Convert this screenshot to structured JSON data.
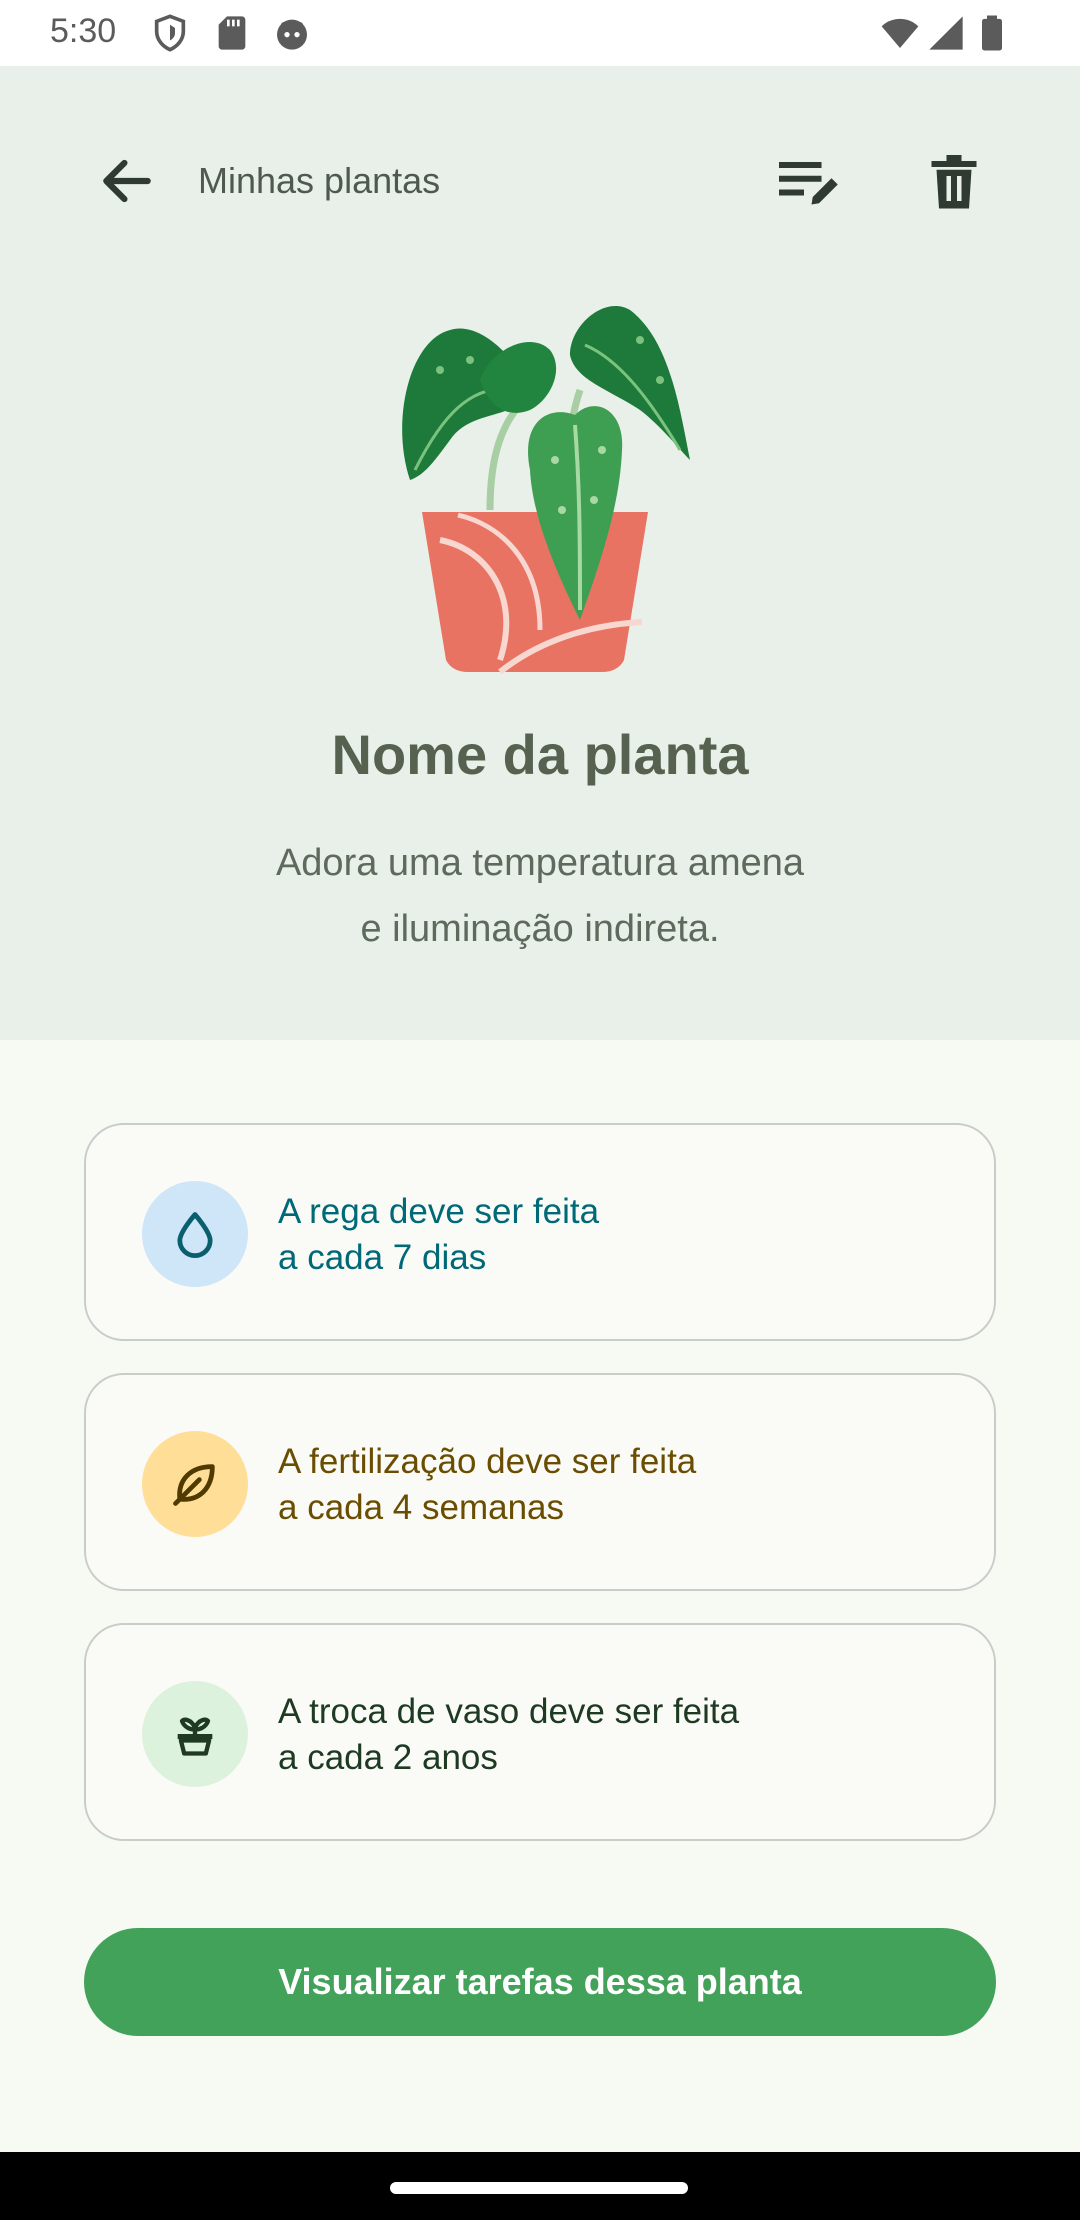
{
  "status_bar": {
    "time": "5:30",
    "left_icons": [
      "shield-icon",
      "sd-card-icon",
      "android-face-icon"
    ],
    "right_icons": [
      "wifi-icon",
      "signal-icon",
      "battery-icon"
    ]
  },
  "appbar": {
    "title": "Minhas plantas",
    "icons": [
      "back-arrow-icon",
      "edit-list-icon",
      "delete-icon"
    ]
  },
  "plant": {
    "name": "Nome da planta",
    "description": "Adora uma temperatura amena e iluminação indireta.",
    "description_line1": "Adora uma temperatura amena",
    "description_line2": "e iluminação indireta."
  },
  "care_cards": [
    {
      "icon": "water-drop-icon",
      "text": "A rega deve ser feita\na cada 7 dias",
      "text_color": "#006977",
      "icon_bg": "#CFE5F8"
    },
    {
      "icon": "leaf-icon",
      "text": "A fertilização deve ser feita\na cada 4 semanas",
      "text_color": "#6A4D00",
      "icon_bg": "#FFDE98"
    },
    {
      "icon": "potted-plant-icon",
      "text": "A troca de vaso deve ser feita\na cada 2 anos",
      "text_color": "#1E3A23",
      "icon_bg": "#DDF2DC"
    }
  ],
  "cta": {
    "label": "Visualizar tarefas dessa planta"
  },
  "colors": {
    "header_bg": "#E9EFE9",
    "page_bg": "#F7F9F3",
    "primary": "#43A25A"
  }
}
